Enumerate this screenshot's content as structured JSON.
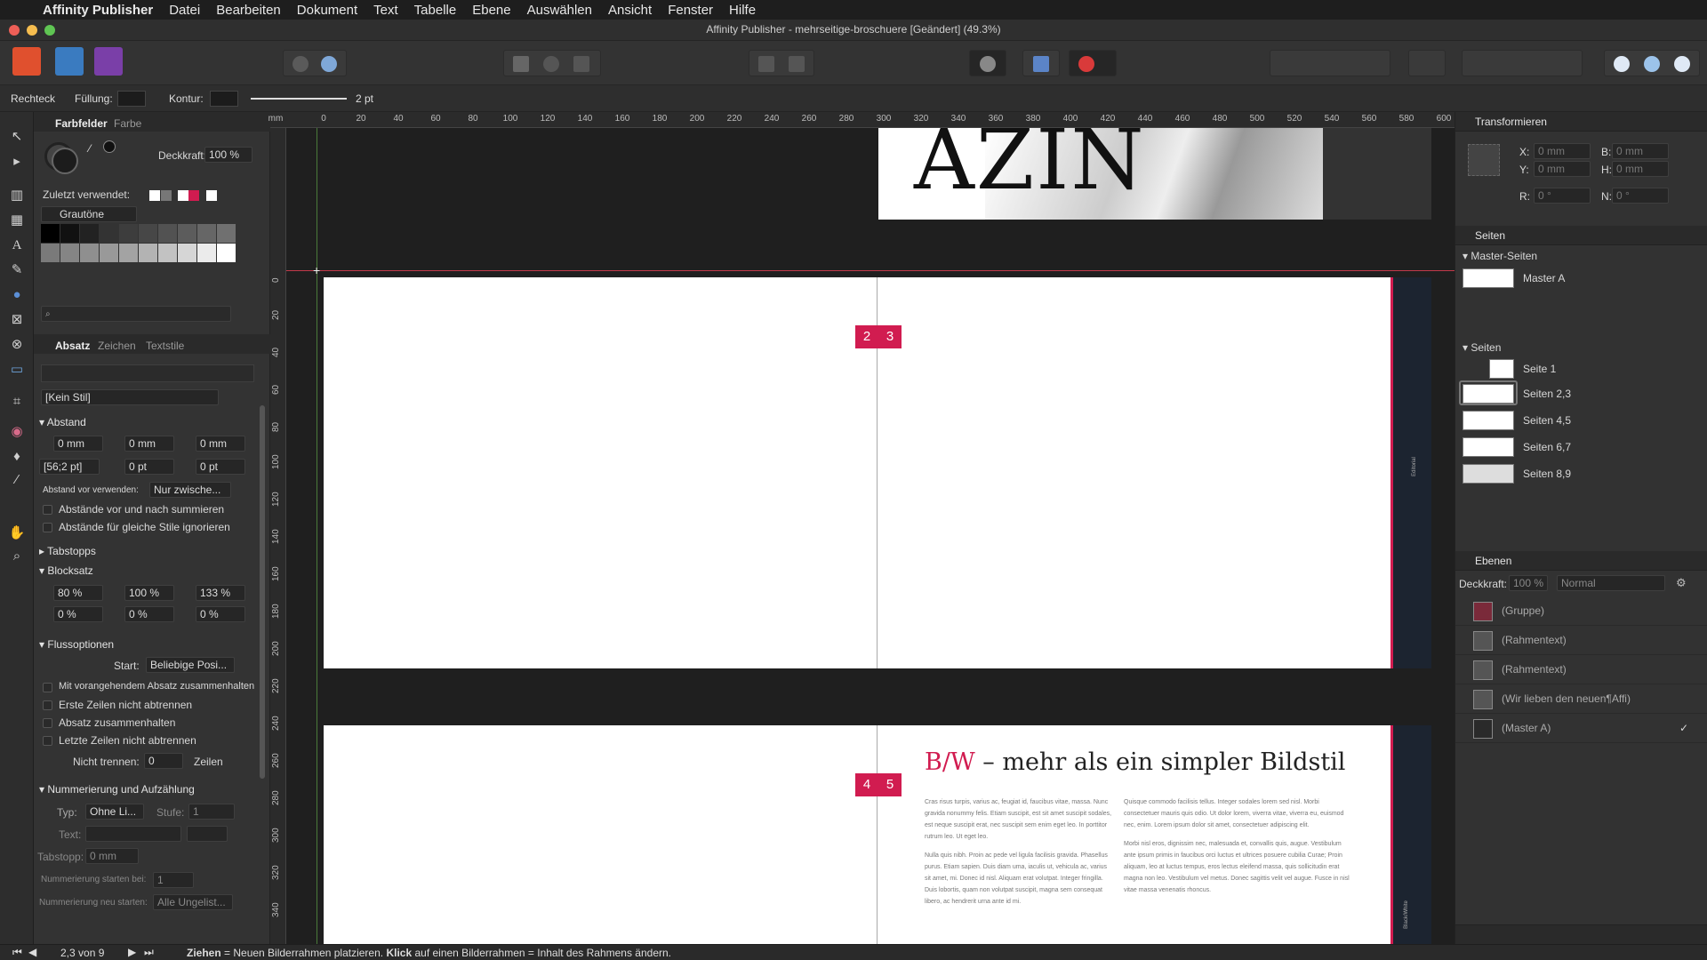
{
  "menubar": {
    "app": "Affinity Publisher",
    "items": [
      "Datei",
      "Bearbeiten",
      "Dokument",
      "Text",
      "Tabelle",
      "Ebene",
      "Auswählen",
      "Ansicht",
      "Fenster",
      "Hilfe"
    ]
  },
  "window": {
    "title": "Affinity Publisher - mehrseitige-broschuere [Geändert] (49.3%)"
  },
  "context": {
    "tool": "Rechteck",
    "fill_label": "Füllung:",
    "stroke_label": "Kontur:",
    "stroke_width": "2 pt"
  },
  "swatches": {
    "tab_active": "Farbfelder",
    "tab_other": "Farbe",
    "opacity_label": "Deckkraft:",
    "opacity": "100 %",
    "recent_label": "Zuletzt verwendet:",
    "palette": "Grautöne",
    "search_placeholder": ""
  },
  "paragraph": {
    "tabs": [
      "Absatz",
      "Zeichen",
      "Textstile"
    ],
    "style": "[Kein Stil]",
    "sections": {
      "spacing": "Abstand",
      "tabs": "Tabstopps",
      "justify": "Blocksatz",
      "flow": "Flussoptionen",
      "numbering": "Nummerierung und Aufzählung"
    },
    "spacing": {
      "left": "0 mm",
      "right": "0 mm",
      "first": "0 mm",
      "leading": "[56;2 pt]",
      "before": "0 pt",
      "after": "0 pt",
      "use_label": "Abstand vor verwenden:",
      "use_value": "Nur zwische...",
      "sum": "Abstände vor und nach summieren",
      "ignore": "Abstände für gleiche Stile ignorieren"
    },
    "justify": {
      "word": "80 %",
      "letter": "100 %",
      "glyph": "133 %",
      "w2": "0 %",
      "l2": "0 %",
      "g2": "0 %"
    },
    "flow": {
      "start_label": "Start:",
      "start_value": "Beliebige Posi...",
      "keep_prev": "Mit vorangehendem Absatz zusammenhalten",
      "no_first": "Erste Zeilen nicht abtrennen",
      "keep_para": "Absatz zusammenhalten",
      "no_last": "Letzte Zeilen nicht abtrennen",
      "nobreak_label": "Nicht trennen:",
      "nobreak_value": "0",
      "lines": "Zeilen"
    },
    "numbering": {
      "type_label": "Typ:",
      "type_value": "Ohne Li...",
      "level_label": "Stufe:",
      "level_value": "1",
      "text_label": "Text:",
      "tab_label": "Tabstopp:",
      "tab_value": "0 mm",
      "start_label": "Nummerierung starten bei:",
      "start_value": "1",
      "restart_label": "Nummerierung neu starten:",
      "restart_value": "Alle Ungelist..."
    }
  },
  "ruler": {
    "h": [
      "0",
      "20",
      "40",
      "60",
      "80",
      "100",
      "120",
      "140",
      "160",
      "180",
      "200",
      "220",
      "240",
      "260",
      "280",
      "300",
      "320",
      "340",
      "360",
      "380",
      "400",
      "420",
      "440",
      "460",
      "480",
      "500",
      "520",
      "540",
      "560",
      "580",
      "600"
    ],
    "v": [
      "0",
      "20",
      "40",
      "60",
      "80",
      "100",
      "120",
      "140",
      "160",
      "180",
      "200",
      "220",
      "240",
      "260",
      "280",
      "300",
      "320",
      "340"
    ],
    "unit": "mm"
  },
  "canvas": {
    "cover_text": "AZIN",
    "badges_top": [
      "2",
      "3"
    ],
    "badges_bottom": [
      "4",
      "5"
    ],
    "headline_accent": "B/W",
    "headline_rest": " – mehr als ein simpler Bildstil",
    "spine_top": "Editorial",
    "spine_bottom": "Black/White",
    "col1": "Cras risus turpis, varius ac, feugiat id, faucibus vitae, massa. Nunc gravida nonummy felis. Etiam suscipit, est sit amet suscipit sodales, est neque suscipit erat, nec suscipit sem enim eget leo. In porttitor rutrum leo. Ut eget leo.",
    "col1b": "Nulla quis nibh. Proin ac pede vel ligula facilisis gravida. Phasellus purus. Etiam sapien. Duis diam uma, iaculis ut, vehicula ac, varius sit amet, mi. Donec id nisl. Aliquam erat volutpat. Integer fringilla. Duis lobortis, quam non volutpat suscipit, magna sem consequat libero, ac hendrerit urna ante id mi.",
    "col2": "Quisque commodo facilisis tellus. Integer sodales lorem sed nisl. Morbi consectetuer mauris quis odio. Ut dolor lorem, viverra vitae, viverra eu, euismod nec, enim. Lorem ipsum dolor sit amet, consectetuer adipiscing elit.",
    "col2b": "Morbi nisl eros, dignissim nec, malesuada et, convallis quis, augue. Vestibulum ante ipsum primis in faucibus orci luctus et ultrices posuere cubilia Curae; Proin aliquam, leo at luctus tempus, eros lectus eleifend massa, quis sollicitudin erat magna non leo. Vestibulum vel metus. Donec sagittis velit vel augue. Fusce in nisl vitae massa venenatis rhoncus."
  },
  "transform": {
    "title": "Transformieren",
    "x_label": "X:",
    "x": "0 mm",
    "y_label": "Y:",
    "y": "0 mm",
    "w_label": "B:",
    "w": "0 mm",
    "h_label": "H:",
    "h": "0 mm",
    "r_label": "R:",
    "r": "0 °",
    "s_label": "N:",
    "s": "0 °"
  },
  "pages": {
    "title": "Seiten",
    "master_section": "Master-Seiten",
    "master": "Master A",
    "pages_section": "Seiten",
    "items": [
      "Seite 1",
      "Seiten 2,3",
      "Seiten 4,5",
      "Seiten 6,7",
      "Seiten 8,9"
    ]
  },
  "layers": {
    "title": "Ebenen",
    "opacity_label": "Deckkraft:",
    "opacity": "100 %",
    "blend": "Normal",
    "items": [
      "(Gruppe)",
      "(Rahmentext)",
      "(Rahmentext)",
      "(Wir lieben den neuen¶Affi)",
      "(Master A)"
    ]
  },
  "status": {
    "page": "2,3 von 9",
    "hint_bold1": "Ziehen",
    "hint1": " = Neuen Bilderrahmen platzieren. ",
    "hint_bold2": "Klick",
    "hint2": " auf einen Bilderrahmen = Inhalt des Rahmens ändern."
  },
  "colors": {
    "accent": "#d11c50",
    "ui": "#333333"
  }
}
